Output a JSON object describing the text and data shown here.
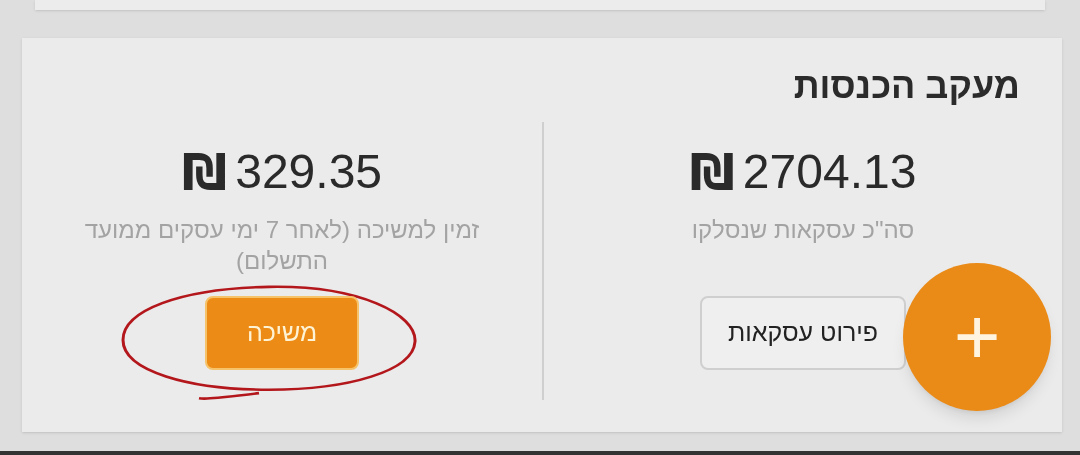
{
  "card": {
    "title": "מעקב הכנסות",
    "stats": [
      {
        "currency": "₪",
        "amount": "2704.13",
        "caption": "סה\"כ עסקאות שנסלקו",
        "button": {
          "label": "פירוט עסקאות",
          "kind": "outline",
          "circled": false
        }
      },
      {
        "currency": "₪",
        "amount": "329.35",
        "caption": "זמין למשיכה (לאחר 7 ימי עסקים ממועד התשלום)",
        "button": {
          "label": "משיכה",
          "kind": "filled",
          "circled": true
        }
      }
    ]
  },
  "fab": {
    "label": "+"
  }
}
